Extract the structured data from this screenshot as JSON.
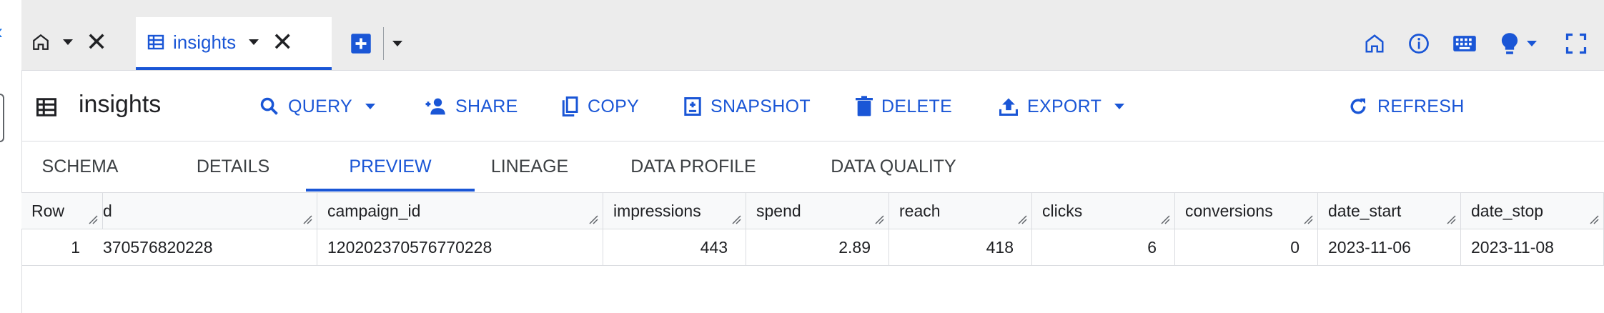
{
  "tabbar": {
    "active_tab_label": "insights"
  },
  "toolbar": {
    "table_title": "insights",
    "query_label": "QUERY",
    "share_label": "SHARE",
    "copy_label": "COPY",
    "snapshot_label": "SNAPSHOT",
    "delete_label": "DELETE",
    "export_label": "EXPORT",
    "refresh_label": "REFRESH"
  },
  "subtabs": {
    "schema": "SCHEMA",
    "details": "DETAILS",
    "preview": "PREVIEW",
    "lineage": "LINEAGE",
    "data_profile": "DATA PROFILE",
    "data_quality": "DATA QUALITY"
  },
  "table": {
    "columns": [
      "Row",
      "d",
      "campaign_id",
      "impressions",
      "spend",
      "reach",
      "clicks",
      "conversions",
      "date_start",
      "date_stop"
    ],
    "rows": [
      [
        "1",
        "370576820228",
        "120202370576770228",
        "443",
        "2.89",
        "418",
        "6",
        "0",
        "2023-11-06",
        "2023-11-08"
      ]
    ]
  },
  "colors": {
    "accent": "#1a56d6",
    "tabbar_bg": "#ececec",
    "border": "#dadce0"
  }
}
